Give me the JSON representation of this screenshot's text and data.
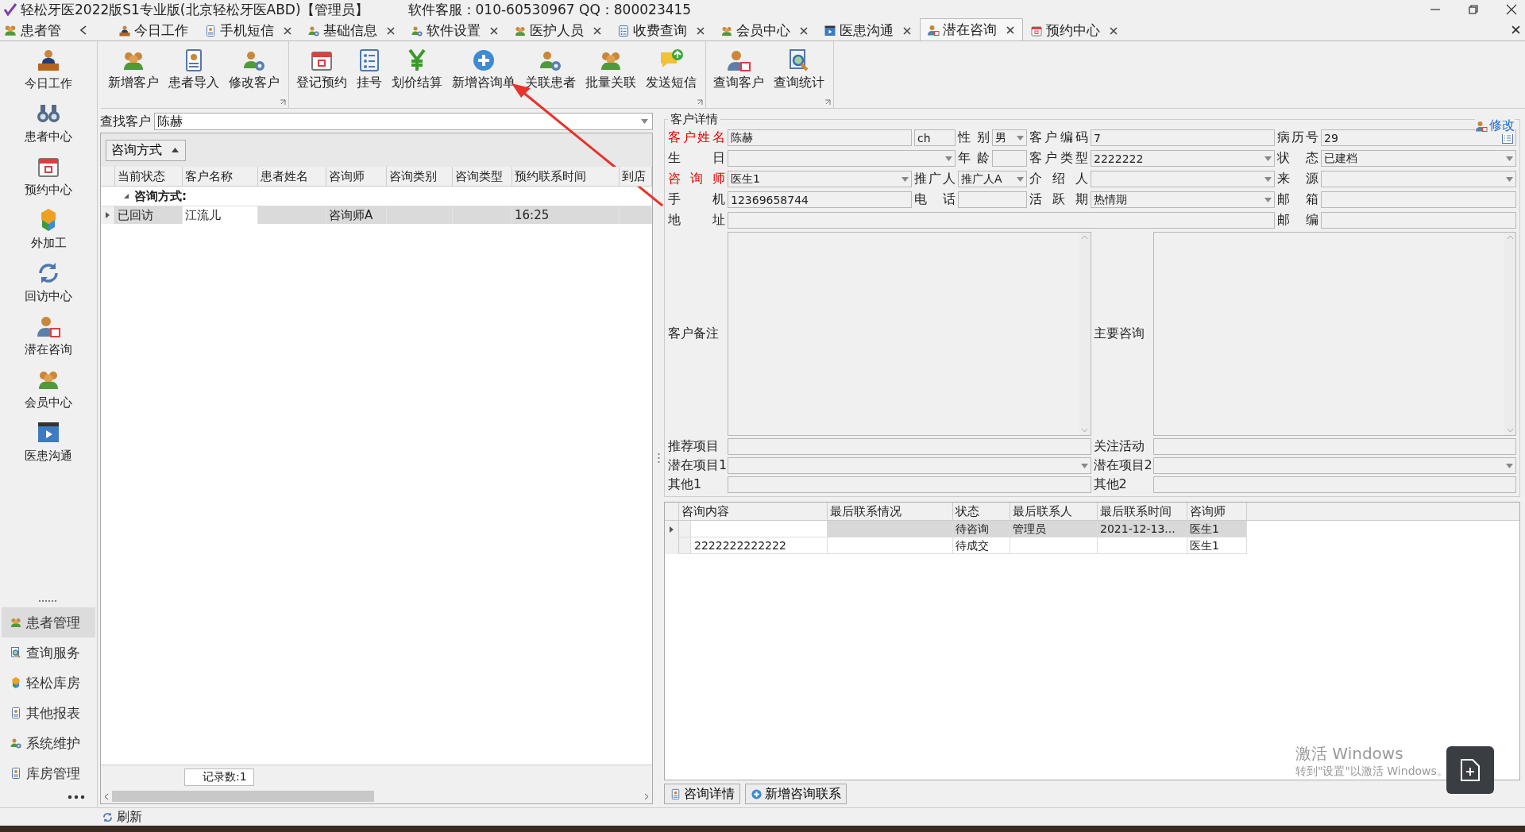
{
  "window": {
    "title": "轻松牙医2022版S1专业版(北京轻松牙医ABD)【管理员】",
    "service": "软件客服：010-60530967 QQ：800023415"
  },
  "panel_header": "患者管",
  "tabs": [
    {
      "label": "今日工作",
      "selected": false,
      "closable": false
    },
    {
      "label": "手机短信",
      "selected": false,
      "closable": true
    },
    {
      "label": "基础信息",
      "selected": false,
      "closable": true
    },
    {
      "label": "软件设置",
      "selected": false,
      "closable": true
    },
    {
      "label": "医护人员",
      "selected": false,
      "closable": true
    },
    {
      "label": "收费查询",
      "selected": false,
      "closable": true
    },
    {
      "label": "会员中心",
      "selected": false,
      "closable": true
    },
    {
      "label": "医患沟通",
      "selected": false,
      "closable": true
    },
    {
      "label": "潜在咨询",
      "selected": true,
      "closable": true
    },
    {
      "label": "预约中心",
      "selected": false,
      "closable": true
    }
  ],
  "nav": [
    "今日工作",
    "患者中心",
    "预约中心",
    "外加工",
    "回访中心",
    "潜在咨询",
    "会员中心",
    "医患沟通"
  ],
  "modules": [
    {
      "label": "患者管理",
      "selected": true
    },
    {
      "label": "查询服务",
      "selected": false
    },
    {
      "label": "轻松库房",
      "selected": false
    },
    {
      "label": "其他报表",
      "selected": false
    },
    {
      "label": "系统维护",
      "selected": false
    },
    {
      "label": "库房管理",
      "selected": false
    }
  ],
  "ribbon": [
    [
      "新增客户",
      "患者导入",
      "修改客户"
    ],
    [
      "登记预约",
      "挂号",
      "划价结算",
      "新增咨询单",
      "关联患者",
      "批量关联",
      "发送短信"
    ],
    [
      "查询客户",
      "查询统计"
    ]
  ],
  "search": {
    "label": "查找客户",
    "value": "陈赫"
  },
  "grid": {
    "group_chip": "咨询方式",
    "columns": [
      "当前状态",
      "客户名称",
      "患者姓名",
      "咨询师",
      "咨询类别",
      "咨询类型",
      "预约联系时间",
      "到店"
    ],
    "group_row": "咨询方式:",
    "rows": [
      {
        "selected": true,
        "cells": [
          {
            "text": "已回访",
            "focused": false
          },
          {
            "text": "江流儿",
            "focused": true
          },
          {
            "focused": false
          },
          {
            "text": "咨询师A",
            "focused": false
          },
          {
            "focused": false
          },
          {
            "focused": false
          },
          {
            "text": "16:25",
            "focused": false
          },
          {
            "focused": false
          }
        ]
      }
    ],
    "record_count": "记录数:1"
  },
  "detail": {
    "title": "客户详情",
    "edit_link": "修改",
    "fields": [
      {
        "label": "客户姓名",
        "value": "陈赫",
        "kind": "text",
        "required": true
      },
      {
        "value": "ch",
        "kind": "text"
      },
      {
        "label": "性别",
        "value": "男",
        "kind": "select",
        "required": false
      },
      {
        "label": "客户编码",
        "value": "7",
        "kind": "text",
        "required": false
      },
      {
        "label": "病历号",
        "value": "29",
        "kind": "lookup",
        "required": false
      },
      {
        "label": "生日",
        "kind": "date",
        "required": false
      },
      {
        "label": "年龄",
        "kind": "text",
        "required": false
      },
      {
        "label": "客户类型",
        "value": "2222222",
        "kind": "select",
        "required": false
      },
      {
        "label": "状态",
        "value": "已建档",
        "kind": "select",
        "required": false
      },
      {
        "label": "咨询师",
        "value": "医生1",
        "kind": "select",
        "required": true
      },
      {
        "label": "推广人",
        "value": "推广人A",
        "kind": "select",
        "required": false
      },
      {
        "label": "介绍人",
        "kind": "select",
        "required": false
      },
      {
        "label": "来源",
        "kind": "select",
        "required": false
      },
      {
        "label": "手机",
        "value": "12369658744",
        "kind": "text",
        "required": false
      },
      {
        "label": "电话",
        "kind": "text",
        "required": false
      },
      {
        "label": "活跃期",
        "value": "热情期",
        "kind": "select",
        "required": false
      },
      {
        "label": "邮箱",
        "kind": "text",
        "required": false
      },
      {
        "label": "地址",
        "kind": "text",
        "required": false
      },
      {
        "label": "邮编",
        "kind": "text",
        "required": false
      }
    ],
    "memos": [
      {
        "label": "客户备注"
      },
      {
        "label": "主要咨询"
      }
    ],
    "extra": [
      {
        "label": "推荐项目",
        "kind": "text"
      },
      {
        "label": "关注活动",
        "kind": "text"
      },
      {
        "label": "潜在项目1",
        "kind": "select"
      },
      {
        "label": "潜在项目2",
        "kind": "select"
      },
      {
        "label": "其他1",
        "kind": "text"
      },
      {
        "label": "其他2",
        "kind": "text"
      }
    ]
  },
  "consult": {
    "columns": [
      "咨询内容",
      "最后联系情况",
      "状态",
      "最后联系人",
      "最后联系时间",
      "咨询师"
    ],
    "rows": [
      {
        "selected": true,
        "cells": [
          "",
          "",
          "待咨询",
          "管理员",
          "2021-12-13...",
          "医生1"
        ]
      },
      {
        "selected": false,
        "cells": [
          "2222222222222",
          "",
          "待成交",
          "",
          "",
          "医生1"
        ]
      }
    ]
  },
  "buttons": [
    "咨询详情",
    "新增咨询联系"
  ],
  "status_bar": "刷新",
  "activation": {
    "title": "激活 Windows",
    "hint": "转到\"设置\"以激活 Windows。"
  }
}
